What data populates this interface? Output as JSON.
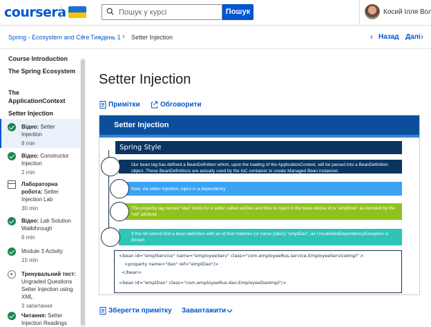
{
  "header": {
    "logo": "coursera",
    "search_placeholder": "Пошук у курсі",
    "search_button": "Пошук",
    "user_name": "Косий Ілля Воло..."
  },
  "breadcrumb": {
    "items": [
      "Spring - Ecosystem and Core",
      "Тиждень 1",
      "Setter Injection"
    ],
    "back": "Назад",
    "next": "Далі"
  },
  "sidebar": {
    "sections": [
      "Course Introduction",
      "The Spring Ecosystem",
      "The ApplicationContext",
      "Setter Injection"
    ],
    "items": [
      {
        "type": "Відео:",
        "title": "Setter Injection",
        "meta": "8 min",
        "status": "done",
        "active": true
      },
      {
        "type": "Відео:",
        "title": "Constructor Injection",
        "meta": "2 min",
        "status": "done",
        "active": false
      },
      {
        "type": "Лабораторна робота:",
        "title": "Setter Injection Lab",
        "meta": "30 min",
        "status": "lab",
        "active": false
      },
      {
        "type": "Відео:",
        "title": "Lab Solution Walkthrough",
        "meta": "6 min",
        "status": "done",
        "active": false
      },
      {
        "type": "",
        "title": "Module 3 Activity",
        "meta": "15 min",
        "status": "done",
        "active": false
      },
      {
        "type": "Тренувальний тест:",
        "title": "Ungraded Questions Setter Injection using XML",
        "meta": "3 запитання",
        "status": "quiz",
        "active": false
      },
      {
        "type": "Читання:",
        "title": "Setter Injection Readings",
        "meta": "",
        "status": "done",
        "active": false
      }
    ]
  },
  "main": {
    "title": "Setter Injection",
    "notes_label": "Примітки",
    "discuss_label": "Обговорити",
    "save_note_label": "Зберегти примітку",
    "download_label": "Завантажити"
  },
  "slide": {
    "header": "Setter Injection",
    "subtitle": "Spring Style",
    "bullets": [
      "Our bean tag has defined a BeanDefinition which, upon the loading of the ApplicationContext, will be parsed into a BeanDefinition object. These BeanDefinitions are actually used by the IoC container to create Managed Bean instances",
      "Now, via setter injection, inject in a dependency",
      "The property tag named “dao” looks for a setter called setDao and tries to inject in the bean whose id is “emplDao” as denoted by the “ref” attribute",
      "If the ref cannot find a bean definition with an id that matches (or name (later)) “emplDao”, an UnsatisfiedDependencyException is thrown"
    ],
    "code": [
      "<bean id=\"emplService\" name=\"employeeServ\" class=\"com.employeeRus.service.EmployeeServiceImpl\" >",
      "<property name=\"dao\" ref=\"emplDao\"/>",
      "</bean>",
      "<bean id=\"emplDao\" class=\"com.employeeRus.dao.EmployeeDaoImpl\"/>"
    ]
  },
  "colors": {
    "brand": "#0056d2",
    "slide_header": "#0b4f9c",
    "dark_navy": "#0b3561",
    "light_blue": "#3ca3f2",
    "green": "#90c21e",
    "teal": "#2ec4b6",
    "done_check": "#1f8354"
  }
}
